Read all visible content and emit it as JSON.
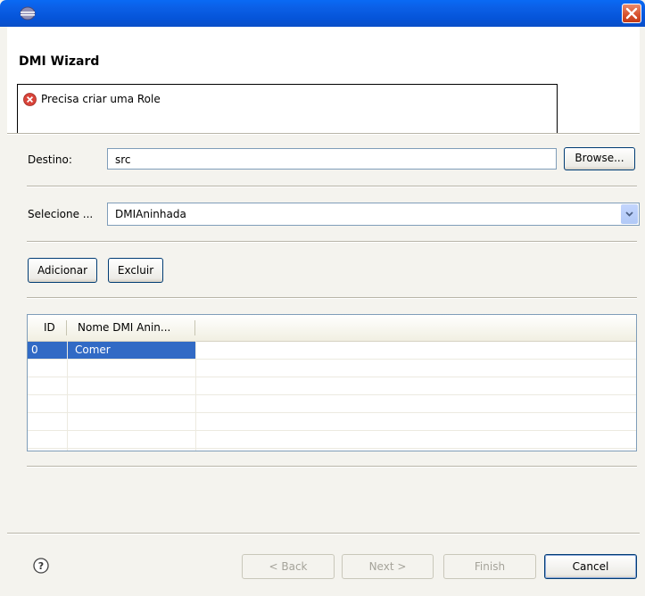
{
  "window": {
    "title": "",
    "close_label": "close"
  },
  "header": {
    "title": "DMI Wizard",
    "message": "Precisa criar uma Role"
  },
  "destino": {
    "label": "Destino:",
    "value": "src",
    "browse_label": "Browse..."
  },
  "selecione": {
    "label": "Selecione ...",
    "value": "DMIAninhada"
  },
  "actions": {
    "add_label": "Adicionar",
    "delete_label": "Excluir"
  },
  "table": {
    "columns": [
      "ID",
      "Nome DMI Anin..."
    ],
    "rows": [
      {
        "id": "0",
        "name": "Comer"
      }
    ]
  },
  "footer": {
    "back_label": "< Back",
    "next_label": "Next >",
    "finish_label": "Finish",
    "cancel_label": "Cancel"
  },
  "colors": {
    "selection": "#316ac5",
    "titlebar": "#0554d8",
    "error": "#d9443a"
  }
}
